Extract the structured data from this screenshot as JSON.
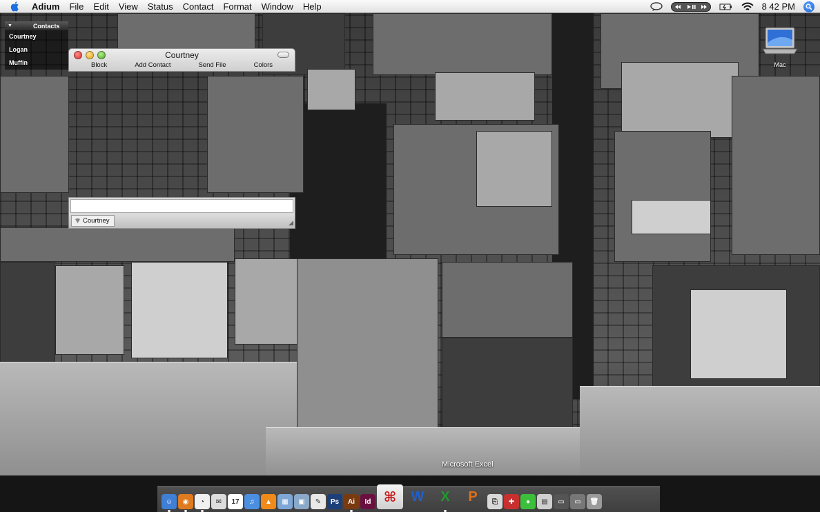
{
  "menubar": {
    "app": "Adium",
    "items": [
      "File",
      "Edit",
      "View",
      "Status",
      "Contact",
      "Format",
      "Window",
      "Help"
    ],
    "clock": "8 42 PM"
  },
  "contact_list": {
    "group": "Contacts",
    "contacts": [
      "Courtney",
      "Logan",
      "Muffin"
    ]
  },
  "chat_window": {
    "title": "Courtney",
    "toolbar": [
      "Block",
      "Add Contact",
      "Send File",
      "Colors"
    ],
    "message_value": "",
    "tab_label": "Courtney"
  },
  "desktop": {
    "drive_label": "Mac"
  },
  "dock": {
    "tooltip": "Microsoft Excel",
    "icons": [
      {
        "name": "finder-icon",
        "color": "#3f7fd6",
        "glyph": "☺"
      },
      {
        "name": "firefox-icon",
        "color": "#e07a1f",
        "glyph": "◉"
      },
      {
        "name": "adium-icon",
        "color": "#f0f0f0",
        "glyph": "◔"
      },
      {
        "name": "mail-icon",
        "color": "#dcdcdc",
        "glyph": "✉"
      },
      {
        "name": "ical-icon",
        "color": "#ffffff",
        "glyph": "17"
      },
      {
        "name": "itunes-icon",
        "color": "#4a8fe0",
        "glyph": "♫"
      },
      {
        "name": "vlc-icon",
        "color": "#f08a1a",
        "glyph": "▲"
      },
      {
        "name": "iphoto-icon",
        "color": "#7fa7d6",
        "glyph": "▦"
      },
      {
        "name": "preview-icon",
        "color": "#8aa8c8",
        "glyph": "▣"
      },
      {
        "name": "textedit-icon",
        "color": "#e8e8e8",
        "glyph": "✎"
      },
      {
        "name": "photoshop-icon",
        "color": "#1c3f7a",
        "glyph": "Ps"
      },
      {
        "name": "illustrator-icon",
        "color": "#7a3a10",
        "glyph": "Ai"
      },
      {
        "name": "indesign-icon",
        "color": "#6a1040",
        "glyph": "Id"
      },
      {
        "name": "acrobat-icon",
        "color": "#c81818",
        "glyph": "⌘"
      },
      {
        "name": "word-icon",
        "color": "#1f5fd0",
        "glyph": "W"
      },
      {
        "name": "excel-icon",
        "color": "#1f9a2f",
        "glyph": "X"
      },
      {
        "name": "powerpoint-icon",
        "color": "#e0701a",
        "glyph": "P"
      },
      {
        "name": "stuffit-icon",
        "color": "#d8d8d8",
        "glyph": "⎘"
      },
      {
        "name": "app-icon",
        "color": "#c83030",
        "glyph": "✚"
      },
      {
        "name": "chat-app-icon",
        "color": "#3cc03c",
        "glyph": "●"
      },
      {
        "name": "calculator-icon",
        "color": "#cfcfcf",
        "glyph": "▤"
      },
      {
        "name": "stack-folder-icon",
        "color": "#555555",
        "glyph": "▭"
      },
      {
        "name": "stack-folder-icon-2",
        "color": "#777777",
        "glyph": "▭"
      },
      {
        "name": "trash-icon",
        "color": "#9a9a9a",
        "glyph": "🗑"
      }
    ]
  }
}
